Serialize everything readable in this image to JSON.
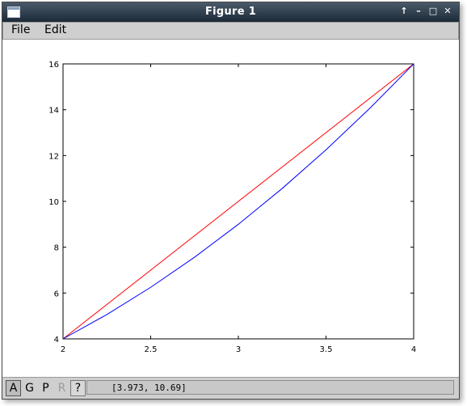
{
  "window": {
    "title": "Figure 1"
  },
  "titlebar_buttons": [
    "↑",
    "–",
    "□",
    "✕"
  ],
  "menu": {
    "file": "File",
    "edit": "Edit"
  },
  "chart_data": {
    "type": "line",
    "title": "",
    "xlabel": "",
    "ylabel": "",
    "xlim": [
      2,
      4
    ],
    "ylim": [
      4,
      16
    ],
    "xticks": [
      "2",
      "2.5",
      "3",
      "3.5",
      "4"
    ],
    "yticks": [
      "4",
      "6",
      "8",
      "10",
      "12",
      "14",
      "16"
    ],
    "grid": false,
    "series": [
      {
        "color": "#ff0000",
        "x": [
          2,
          4
        ],
        "y": [
          4,
          16
        ]
      },
      {
        "color": "#0000ff",
        "x": [
          2,
          2.25,
          2.5,
          2.75,
          3,
          3.25,
          3.5,
          3.75,
          4
        ],
        "y": [
          4,
          5.0625,
          6.25,
          7.5625,
          9,
          10.5625,
          12.25,
          14.0625,
          16
        ]
      }
    ]
  },
  "statusbar": {
    "buttons": [
      "A",
      "G",
      "P",
      "R",
      "?"
    ],
    "coords": "[3.973, 10.69]"
  }
}
